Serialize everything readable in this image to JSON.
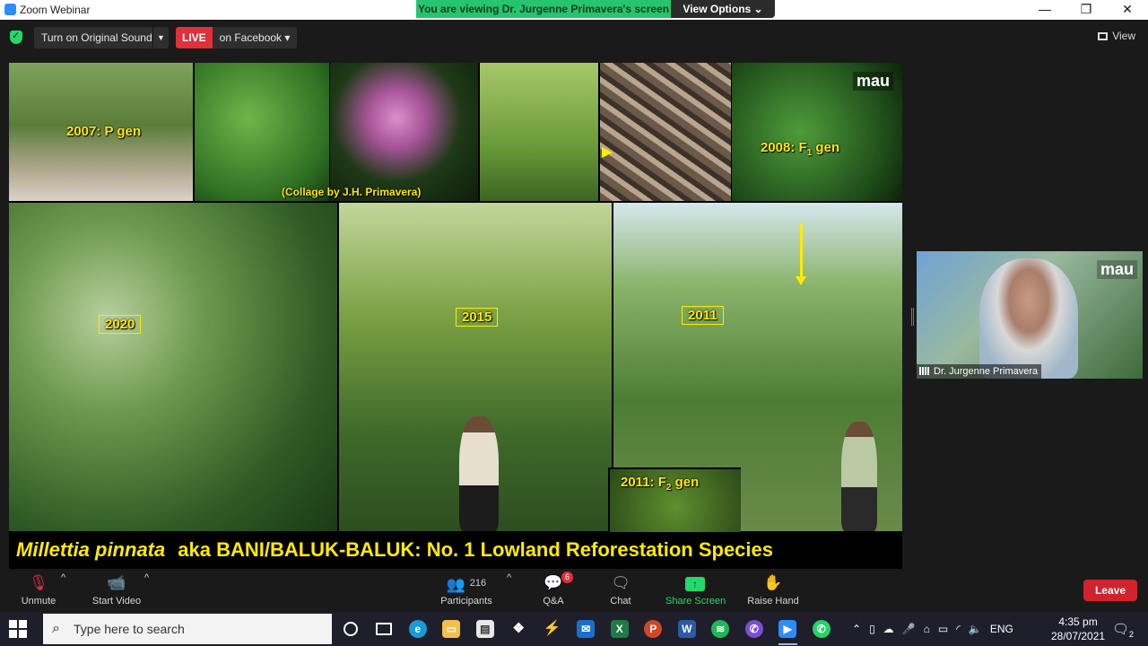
{
  "window": {
    "title": "Zoom Webinar",
    "controls": {
      "minimize": "—",
      "restore": "❐",
      "close": "✕"
    }
  },
  "banner": {
    "viewing_text": "You are viewing Dr. Jurgenne Primavera's screen",
    "view_options": "View Options ⌄"
  },
  "top_toolbar": {
    "original_sound": "Turn on Original Sound",
    "live_badge": "LIVE",
    "live_target": "on Facebook",
    "view_label": "View"
  },
  "slide": {
    "label_2007": "2007: P gen",
    "collage_credit": "(Collage by J.H. Primavera)",
    "mau_slide": "mau",
    "label_2008": "2008: F",
    "label_2008_sub": "1",
    "label_2008_suffix": " gen",
    "label_2020": "2020",
    "label_2015": "2015",
    "label_2011": "2011",
    "label_2011f": "2011: F",
    "label_2011f_sub": "2",
    "label_2011f_suffix": " gen",
    "caption_italic": "Millettia pinnata",
    "caption_rest": "aka BANI/BALUK-BALUK: No. 1 Lowland Reforestation Species"
  },
  "video_tile": {
    "mau": "mau",
    "name": "Dr. Jurgenne Primavera"
  },
  "controls": {
    "unmute": "Unmute",
    "start_video": "Start Video",
    "participants": "Participants",
    "participants_count": "216",
    "qa": "Q&A",
    "qa_badge": "6",
    "chat": "Chat",
    "share_screen": "Share Screen",
    "raise_hand": "Raise Hand",
    "leave": "Leave"
  },
  "taskbar": {
    "search_placeholder": "Type here to search",
    "language": "ENG",
    "time": "4:35 pm",
    "date": "28/07/2021",
    "notifications": "2"
  },
  "colors": {
    "zoom_green": "#23d96c",
    "live_red": "#e0303a",
    "slide_yellow": "#ffeb00",
    "leave_red": "#d0232e"
  }
}
